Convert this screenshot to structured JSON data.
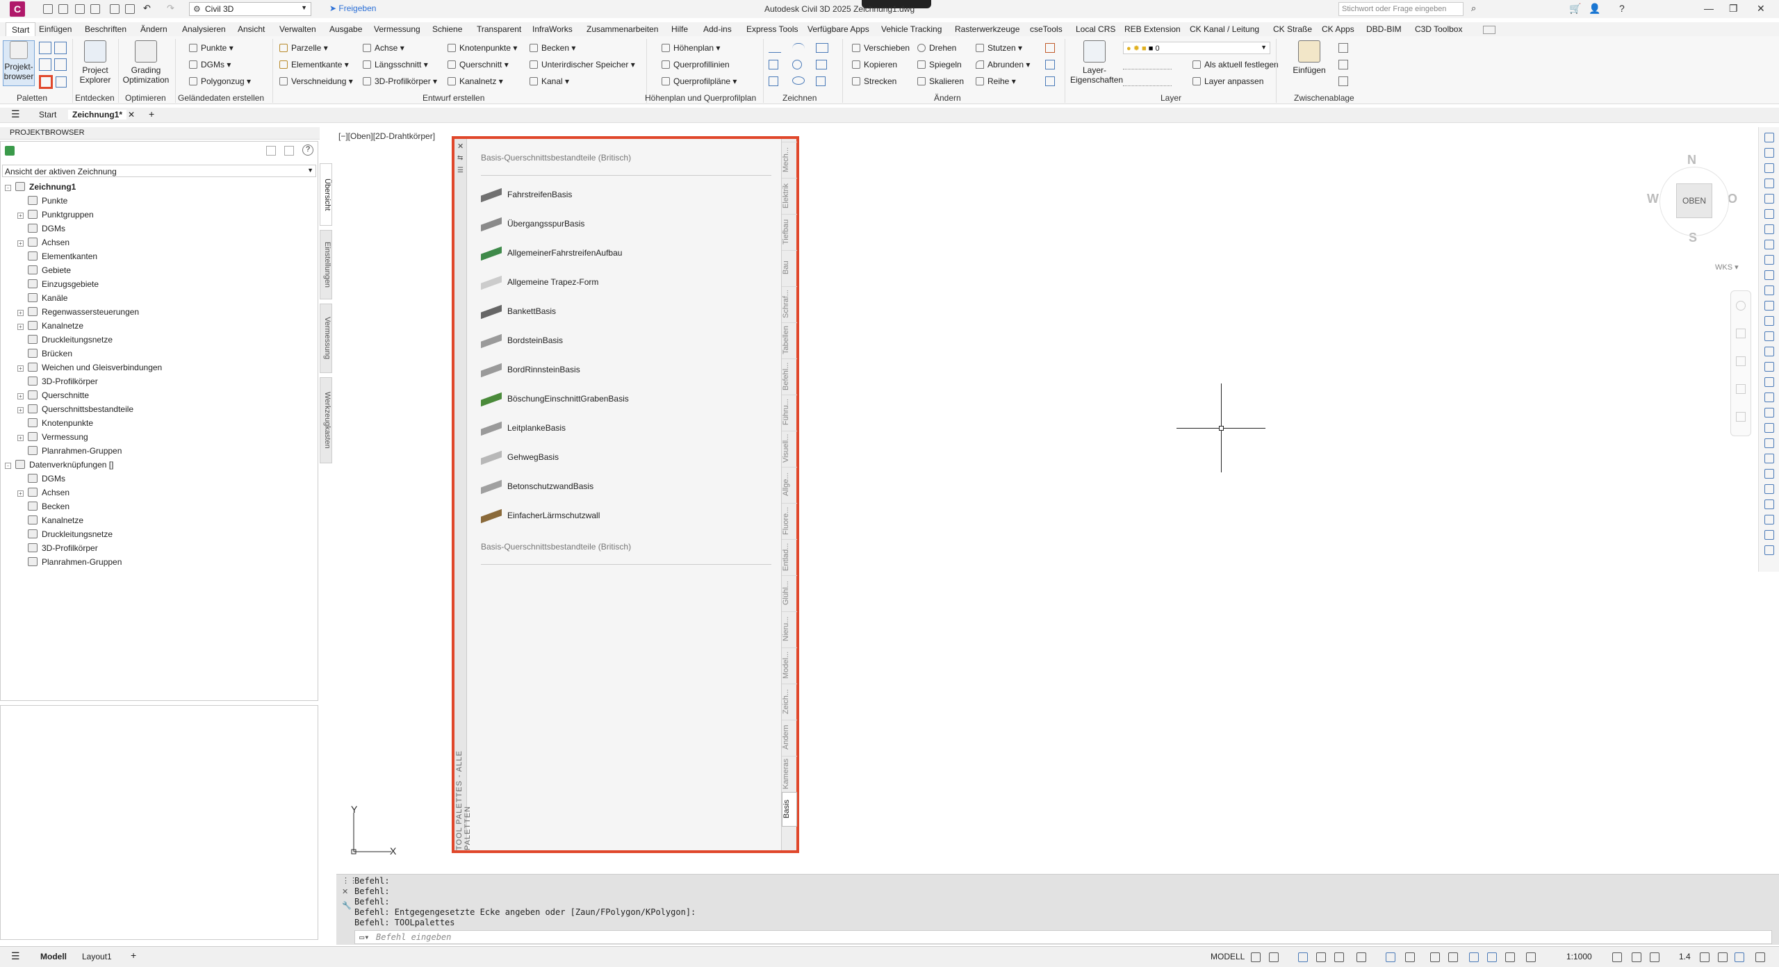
{
  "app": {
    "logo": "C",
    "title": "Autodesk Civil 3D 2025  Zeichnung1.dwg",
    "workspace": "Civil 3D",
    "share_label": "Freigeben",
    "search_placeholder": "Stichwort oder Frage eingeben"
  },
  "ribbon_tabs": [
    "Start",
    "Einfügen",
    "Beschriften",
    "Ändern",
    "Analysieren",
    "Ansicht",
    "Verwalten",
    "Ausgabe",
    "Vermessung",
    "Schiene",
    "Transparent",
    "InfraWorks",
    "Zusammenarbeiten",
    "Hilfe",
    "Add-ins",
    "Express Tools",
    "Verfügbare Apps",
    "Vehicle Tracking",
    "Rasterwerkzeuge",
    "cseTools",
    "Local CRS",
    "REB Extension",
    "CK Kanal / Leitung",
    "CK Straße",
    "CK Apps",
    "DBD-BIM",
    "C3D Toolbox"
  ],
  "ribbon": {
    "paletten": {
      "title": "Paletten",
      "projektbrowser": "Projekt-\nbrowser"
    },
    "entdecken": {
      "title": "Entdecken",
      "project_explorer": "Project\nExplorer"
    },
    "optimieren": {
      "title": "Optimieren",
      "grading": "Grading\nOptimization"
    },
    "gelaende": {
      "title": "Geländedaten erstellen",
      "items": [
        "Punkte",
        "DGMs",
        "Polygonzug"
      ]
    },
    "entwurf": {
      "title": "Entwurf erstellen",
      "items": [
        "Parzelle",
        "Elementkante",
        "Verschneidung",
        "Achse",
        "Längsschnitt",
        "3D-Profilkörper",
        "Knotenpunkte",
        "Querschnitt",
        "Kanalnetz",
        "Becken",
        "Unterirdischer Speicher",
        "Kanal"
      ]
    },
    "hoehenplan": {
      "title": "Höhenplan und Querprofilplan",
      "items": [
        "Höhenplan",
        "Querprofillinien",
        "Querprofilpläne"
      ]
    },
    "zeichnen": {
      "title": "Zeichnen"
    },
    "aendern": {
      "title": "Ändern",
      "items": [
        "Verschieben",
        "Kopieren",
        "Strecken",
        "Drehen",
        "Spiegeln",
        "Skalieren",
        "Stutzen",
        "Abrunden",
        "Reihe"
      ]
    },
    "layer": {
      "title": "Layer",
      "eigenschaften": "Layer-\nEigenschaften",
      "current": "0",
      "items": [
        "Als aktuell festlegen",
        "Layer anpassen"
      ]
    },
    "zwischenablage": {
      "title": "Zwischenablage",
      "einfuegen": "Einfügen"
    }
  },
  "doc_tabs": {
    "start": "Start",
    "active": "Zeichnung1*"
  },
  "project_browser": {
    "title": "PROJEKTBROWSER",
    "view_select": "Ansicht der aktiven Zeichnung",
    "side_tabs": [
      "Übersicht",
      "Einstellungen",
      "Vermessung",
      "Werkzeugkasten"
    ],
    "tree": [
      {
        "label": "Zeichnung1",
        "level": 0,
        "exp": "-",
        "bold": true
      },
      {
        "label": "Punkte",
        "level": 1,
        "exp": ""
      },
      {
        "label": "Punktgruppen",
        "level": 1,
        "exp": "+"
      },
      {
        "label": "DGMs",
        "level": 1,
        "exp": ""
      },
      {
        "label": "Achsen",
        "level": 1,
        "exp": "+"
      },
      {
        "label": "Elementkanten",
        "level": 1,
        "exp": ""
      },
      {
        "label": "Gebiete",
        "level": 1,
        "exp": ""
      },
      {
        "label": "Einzugsgebiete",
        "level": 1,
        "exp": ""
      },
      {
        "label": "Kanäle",
        "level": 1,
        "exp": ""
      },
      {
        "label": "Regenwassersteuerungen",
        "level": 1,
        "exp": "+"
      },
      {
        "label": "Kanalnetze",
        "level": 1,
        "exp": "+"
      },
      {
        "label": "Druckleitungsnetze",
        "level": 1,
        "exp": ""
      },
      {
        "label": "Brücken",
        "level": 1,
        "exp": ""
      },
      {
        "label": "Weichen und Gleisverbindungen",
        "level": 1,
        "exp": "+"
      },
      {
        "label": "3D-Profilkörper",
        "level": 1,
        "exp": ""
      },
      {
        "label": "Querschnitte",
        "level": 1,
        "exp": "+"
      },
      {
        "label": "Querschnittsbestandteile",
        "level": 1,
        "exp": "+"
      },
      {
        "label": "Knotenpunkte",
        "level": 1,
        "exp": ""
      },
      {
        "label": "Vermessung",
        "level": 1,
        "exp": "+"
      },
      {
        "label": "Planrahmen-Gruppen",
        "level": 1,
        "exp": ""
      },
      {
        "label": "Datenverknüpfungen []",
        "level": 0,
        "exp": "-",
        "bold": false
      },
      {
        "label": "DGMs",
        "level": 1,
        "exp": ""
      },
      {
        "label": "Achsen",
        "level": 1,
        "exp": "+"
      },
      {
        "label": "Becken",
        "level": 1,
        "exp": ""
      },
      {
        "label": "Kanalnetze",
        "level": 1,
        "exp": ""
      },
      {
        "label": "Druckleitungsnetze",
        "level": 1,
        "exp": ""
      },
      {
        "label": "3D-Profilkörper",
        "level": 1,
        "exp": ""
      },
      {
        "label": "Planrahmen-Gruppen",
        "level": 1,
        "exp": ""
      }
    ]
  },
  "viewport": {
    "label": "[−][Oben][2D-Drahtkörper]",
    "viewcube": {
      "n": "N",
      "s": "S",
      "w": "W",
      "o": "O",
      "top": "OBEN",
      "wks": "WKS"
    },
    "ucs": {
      "x": "X",
      "y": "Y"
    }
  },
  "tool_palette": {
    "title": "TOOL PALETTES - ALLE PALETTEN",
    "header": "Basis-Querschnittsbestandteile (Britisch)",
    "footer": "Basis-Querschnittsbestandteile (Britisch)",
    "items": [
      {
        "label": "FahrstreifenBasis",
        "color": "#707070"
      },
      {
        "label": "ÜbergangsspurBasis",
        "color": "#8a8a8a"
      },
      {
        "label": "AllgemeinerFahrstreifenAufbau",
        "color": "#3f8a4a"
      },
      {
        "label": "Allgemeine Trapez-Form",
        "color": "#cccccc"
      },
      {
        "label": "BankettBasis",
        "color": "#666666"
      },
      {
        "label": "BordsteinBasis",
        "color": "#9a9a9a"
      },
      {
        "label": "BordRinnsteinBasis",
        "color": "#9a9a9a"
      },
      {
        "label": "BöschungEinschnittGrabenBasis",
        "color": "#4a8a3a"
      },
      {
        "label": "LeitplankeBasis",
        "color": "#9a9a9a"
      },
      {
        "label": "GehwegBasis",
        "color": "#b8b8b8"
      },
      {
        "label": "BetonschutzwandBasis",
        "color": "#a0a0a0"
      },
      {
        "label": "EinfacherLärmschutzwall",
        "color": "#8a6a3a"
      }
    ],
    "tabs": [
      "Mech...",
      "Elektrik",
      "Tiefbau",
      "Bau",
      "Schraf...",
      "Tabellen",
      "Befehl...",
      "Führu...",
      "Visuell...",
      "Allge...",
      "Fluore...",
      "Entlad...",
      "Glühl...",
      "Nieru...",
      "Model...",
      "Zeich...",
      "Ändern",
      "Kameras",
      "Basis"
    ],
    "active_tab": "Basis"
  },
  "command_line": {
    "history": [
      "Befehl:",
      "Befehl:",
      "Befehl:",
      "Befehl: Entgegengesetzte Ecke angeben oder [Zaun/FPolygon/KPolygon]:",
      "Befehl: TOOLpalettes"
    ],
    "placeholder": "Befehl eingeben"
  },
  "statusbar": {
    "layouts": [
      "Modell",
      "Layout1"
    ],
    "model_label": "MODELL",
    "scale": "1:1000",
    "annoscale": "1.4"
  }
}
